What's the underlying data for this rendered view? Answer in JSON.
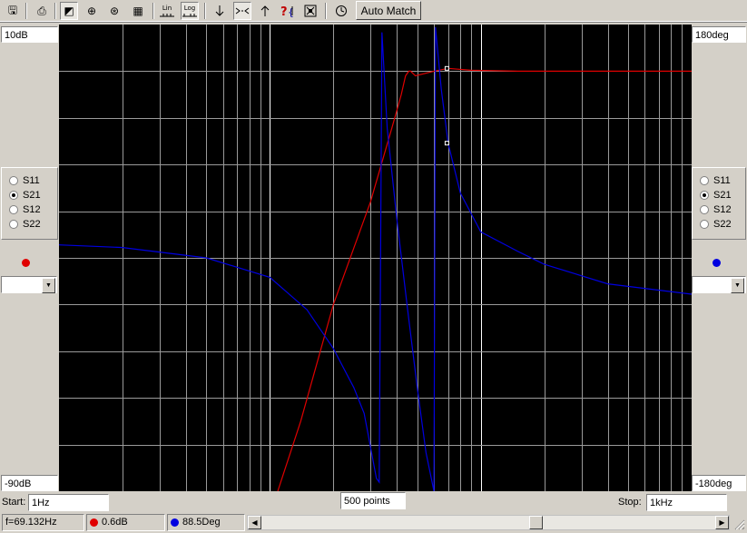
{
  "toolbar": {
    "buttons": [
      {
        "name": "save-icon",
        "glyph": "🖫"
      },
      {
        "name": "print-icon",
        "glyph": "⎙"
      },
      {
        "name": "rect-plot-icon",
        "glyph": "◩"
      },
      {
        "name": "polar-plot-icon",
        "glyph": "⊕"
      },
      {
        "name": "smith-chart-icon",
        "glyph": "⊛"
      },
      {
        "name": "table-icon",
        "glyph": "▦"
      }
    ],
    "lin_label": "Lin",
    "log_label": "Log",
    "auto_match_label": "Auto Match"
  },
  "left_panel": {
    "top_value": "10dB",
    "bottom_value": "-90dB",
    "params": [
      "S11",
      "S21",
      "S12",
      "S22"
    ],
    "selected": "S21",
    "trace_color": "#e00000"
  },
  "right_panel": {
    "top_value": "180deg",
    "bottom_value": "-180deg",
    "params": [
      "S11",
      "S21",
      "S12",
      "S22"
    ],
    "selected": "S21",
    "trace_color": "#0000e0"
  },
  "sweep": {
    "start_label": "Start:",
    "start_value": "1Hz",
    "points": "500 points",
    "stop_label": "Stop:",
    "stop_value": "1kHz"
  },
  "status": {
    "frequency": "f=69.132Hz",
    "magnitude": "0.6dB",
    "phase": "88.5Deg"
  },
  "chart_data": {
    "type": "line",
    "x_scale": "log",
    "xlim": [
      1,
      1000
    ],
    "grid": true,
    "series": [
      {
        "axis": "left",
        "color": "#e00000",
        "ylim": [
          -90,
          10
        ],
        "points": [
          [
            10.9,
            -90
          ],
          [
            14,
            -75
          ],
          [
            20,
            -50
          ],
          [
            30,
            -28
          ],
          [
            38,
            -12
          ],
          [
            42,
            -5
          ],
          [
            44,
            -1
          ],
          [
            45.6,
            0
          ],
          [
            46.5,
            0
          ],
          [
            49,
            -1
          ],
          [
            60,
            0
          ],
          [
            70,
            0.6
          ],
          [
            90,
            0.2
          ],
          [
            150,
            0
          ],
          [
            400,
            0
          ],
          [
            1000,
            0
          ]
        ]
      },
      {
        "axis": "right",
        "color": "#0000e0",
        "ylim": [
          -180,
          180
        ],
        "points": [
          [
            1,
            10
          ],
          [
            2,
            8
          ],
          [
            5,
            0
          ],
          [
            10,
            -15
          ],
          [
            15,
            -40
          ],
          [
            20,
            -70
          ],
          [
            25,
            -100
          ],
          [
            28,
            -120
          ],
          [
            32,
            -170
          ],
          [
            33,
            -173
          ],
          [
            33,
            -173
          ],
          [
            34,
            174
          ],
          [
            36,
            100
          ],
          [
            40,
            30
          ],
          [
            45,
            -40
          ],
          [
            50,
            -100
          ],
          [
            55,
            -150
          ],
          [
            60,
            -180
          ],
          [
            60,
            -180
          ],
          [
            61,
            178
          ],
          [
            65,
            130
          ],
          [
            70,
            88.5
          ],
          [
            80,
            50
          ],
          [
            100,
            20
          ],
          [
            150,
            5
          ],
          [
            200,
            -5
          ],
          [
            400,
            -20
          ],
          [
            1000,
            -28
          ]
        ]
      }
    ]
  }
}
